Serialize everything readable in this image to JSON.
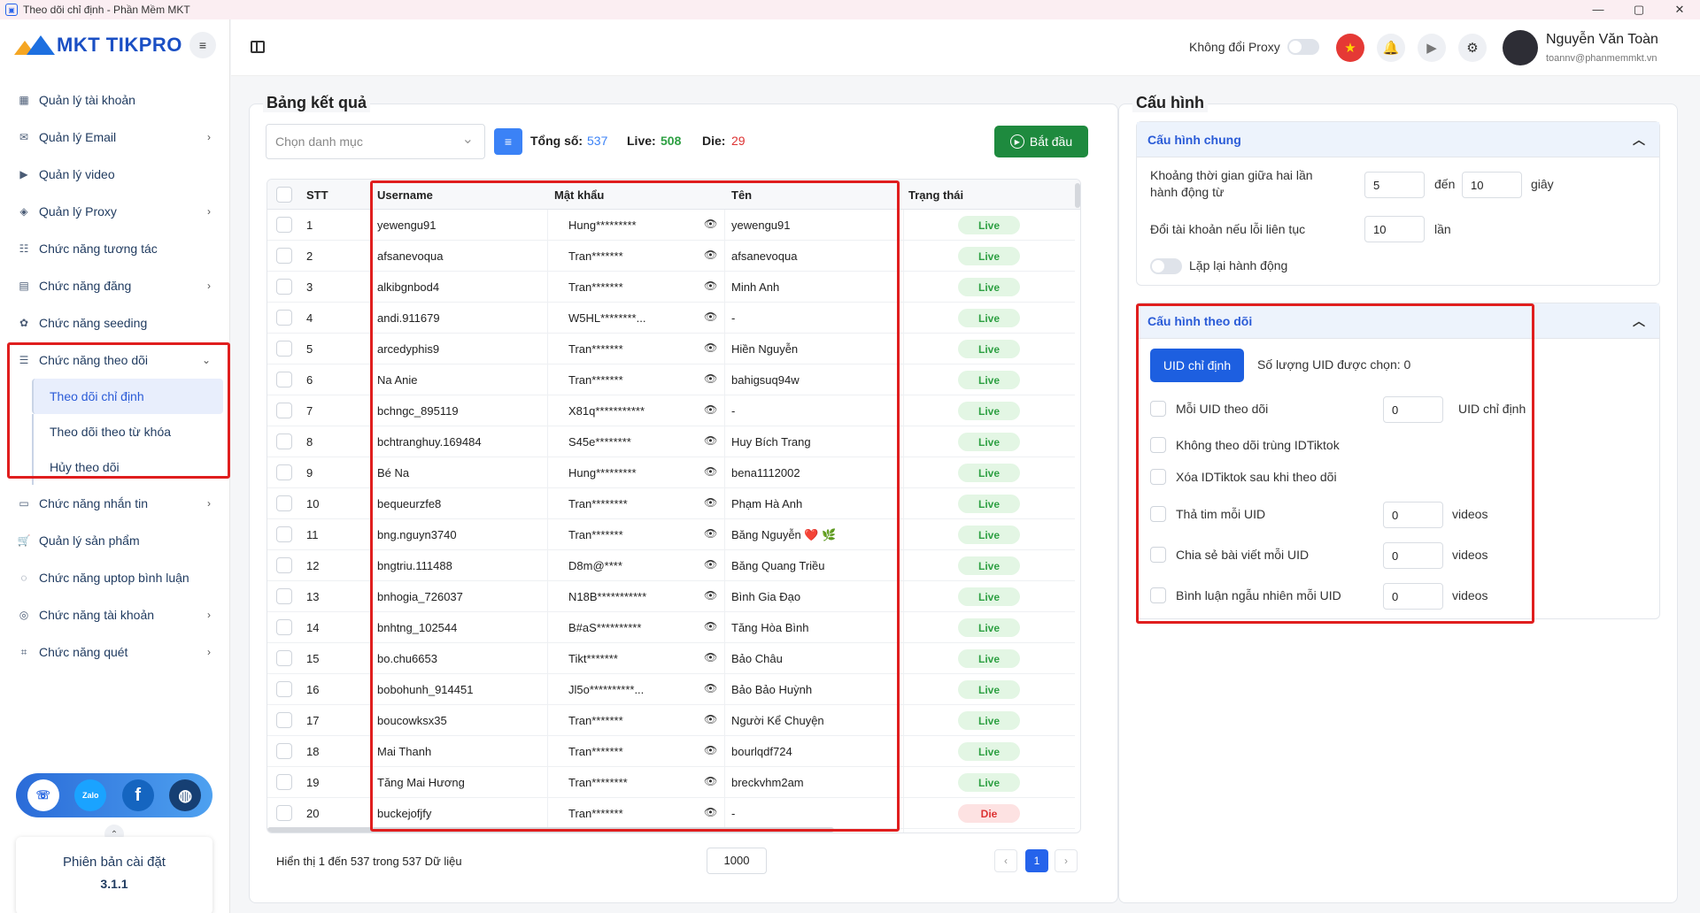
{
  "window": {
    "title": "Theo dõi chỉ định - Phần Mềm MKT",
    "controls": [
      "—",
      "▢",
      "✕"
    ]
  },
  "logo": {
    "text": "MKT TIKPRO"
  },
  "menu": [
    {
      "label": "Quản lý tài khoản",
      "icon": "dashboard-icon",
      "chev": ""
    },
    {
      "label": "Quản lý Email",
      "icon": "mail-icon",
      "chev": "›"
    },
    {
      "label": "Quản lý video",
      "icon": "video-icon",
      "chev": ""
    },
    {
      "label": "Quản lý Proxy",
      "icon": "layers-icon",
      "chev": "›"
    },
    {
      "label": "Chức năng tương tác",
      "icon": "interact-icon",
      "chev": ""
    },
    {
      "label": "Chức năng đăng",
      "icon": "post-icon",
      "chev": "›"
    },
    {
      "label": "Chức năng seeding",
      "icon": "seeding-icon",
      "chev": ""
    },
    {
      "label": "Chức năng theo dõi",
      "icon": "follow-icon",
      "chev": "⌄"
    },
    {
      "label": "Chức năng nhắn tin",
      "icon": "message-icon",
      "chev": "›"
    },
    {
      "label": "Quản lý sản phẩm",
      "icon": "cart-icon",
      "chev": ""
    },
    {
      "label": "Chức năng uptop bình luận",
      "icon": "comment-icon",
      "chev": ""
    },
    {
      "label": "Chức năng tài khoản",
      "icon": "account-icon",
      "chev": "›"
    },
    {
      "label": "Chức năng quét",
      "icon": "scan-icon",
      "chev": "›"
    }
  ],
  "submenu": [
    "Theo dõi chỉ định",
    "Theo dõi theo từ khóa",
    "Hủy theo dõi"
  ],
  "social": [
    "support",
    "Zalo",
    "f",
    "web"
  ],
  "version": {
    "label": "Phiên bản cài đặt",
    "value": "3.1.1"
  },
  "topbar": {
    "proxy_label": "Không đổi Proxy",
    "user_name": "Nguyễn Văn Toàn",
    "user_email": "toannv@phanmemmkt.vn"
  },
  "results": {
    "title": "Bảng kết quả",
    "category_placeholder": "Chọn danh mục",
    "total_label": "Tổng số:",
    "total": "537",
    "live_label": "Live:",
    "live": "508",
    "die_label": "Die:",
    "die": "29",
    "start_label": "Bắt đầu",
    "columns": [
      "STT",
      "Username",
      "Mật khẩu",
      "Tên",
      "Trạng thái"
    ],
    "rows": [
      {
        "stt": "1",
        "user": "yewengu91",
        "pass": "Hung*********",
        "name": "yewengu91",
        "status": "Live"
      },
      {
        "stt": "2",
        "user": "afsanevoqua",
        "pass": "Tran*******",
        "name": "afsanevoqua",
        "status": "Live"
      },
      {
        "stt": "3",
        "user": "alkibgnbod4",
        "pass": "Tran*******",
        "name": "Minh Anh",
        "status": "Live"
      },
      {
        "stt": "4",
        "user": "andi.911679",
        "pass": "W5HL********...",
        "name": "-",
        "status": "Live"
      },
      {
        "stt": "5",
        "user": "arcedyphis9",
        "pass": "Tran*******",
        "name": "Hiền Nguyễn",
        "status": "Live"
      },
      {
        "stt": "6",
        "user": "Na Anie",
        "pass": "Tran*******",
        "name": "bahigsuq94w",
        "status": "Live"
      },
      {
        "stt": "7",
        "user": "bchngc_895119",
        "pass": "X81q***********",
        "name": "-",
        "status": "Live"
      },
      {
        "stt": "8",
        "user": "bchtranghuy.169484",
        "pass": "S45e********",
        "name": "Huy Bích Trang",
        "status": "Live"
      },
      {
        "stt": "9",
        "user": "Bé Na",
        "pass": "Hung*********",
        "name": "bena1112002",
        "status": "Live"
      },
      {
        "stt": "10",
        "user": "bequeurzfe8",
        "pass": "Tran********",
        "name": "Phạm Hà Anh",
        "status": "Live"
      },
      {
        "stt": "11",
        "user": "bng.nguyn3740",
        "pass": "Tran*******",
        "name": "Băng Nguyễn ❤️ 🌿",
        "status": "Live"
      },
      {
        "stt": "12",
        "user": "bngtriu.111488",
        "pass": "D8m@****",
        "name": "Băng Quang Triều",
        "status": "Live"
      },
      {
        "stt": "13",
        "user": "bnhogia_726037",
        "pass": "N18B***********",
        "name": "Bình Gia Đạo",
        "status": "Live"
      },
      {
        "stt": "14",
        "user": "bnhtng_102544",
        "pass": "B#aS**********",
        "name": "Tăng Hòa Bình",
        "status": "Live"
      },
      {
        "stt": "15",
        "user": "bo.chu6653",
        "pass": "Tikt*******",
        "name": "Bảo Châu",
        "status": "Live"
      },
      {
        "stt": "16",
        "user": "bobohunh_914451",
        "pass": "Jl5o**********...",
        "name": "Bảo Bảo Huỳnh",
        "status": "Live"
      },
      {
        "stt": "17",
        "user": "boucowksx35",
        "pass": "Tran*******",
        "name": "Người Kể Chuyện",
        "status": "Live"
      },
      {
        "stt": "18",
        "user": "Mai Thanh",
        "pass": "Tran*******",
        "name": "bourlqdf724",
        "status": "Live"
      },
      {
        "stt": "19",
        "user": "Tăng Mai Hương",
        "pass": "Tran********",
        "name": "breckvhm2am",
        "status": "Live"
      },
      {
        "stt": "20",
        "user": "buckejofjfy",
        "pass": "Tran*******",
        "name": "-",
        "status": "Die"
      }
    ],
    "footer": "Hiển thị 1 đến 537 trong 537 Dữ liệu",
    "page_size": "1000",
    "page": "1"
  },
  "config": {
    "title": "Cấu hình",
    "general": {
      "title": "Cấu hình chung",
      "interval_label": "Khoảng thời gian giữa hai lần hành động từ",
      "interval_from": "5",
      "to_label": "đến",
      "interval_to": "10",
      "unit_sec": "giây",
      "switch_label": "Đổi tài khoản nếu lỗi liên tục",
      "switch_value": "10",
      "unit_times": "lần",
      "repeat_label": "Lặp lại hành động"
    },
    "follow": {
      "title": "Cấu hình theo dõi",
      "uid_button": "UID chỉ định",
      "uid_count": "Số lượng UID được chọn: 0",
      "each_uid_label": "Mỗi UID theo dõi",
      "each_uid_value": "0",
      "each_uid_unit": "UID chỉ định",
      "no_dup_label": "Không theo dõi trùng IDTiktok",
      "delete_label": "Xóa IDTiktok sau khi theo dõi",
      "heart_label": "Thả tim mỗi UID",
      "heart_value": "0",
      "share_label": "Chia sẻ bài viết mỗi UID",
      "share_value": "0",
      "comment_label": "Bình luận ngẫu nhiên mỗi UID",
      "comment_value": "0",
      "unit_videos": "videos"
    }
  }
}
